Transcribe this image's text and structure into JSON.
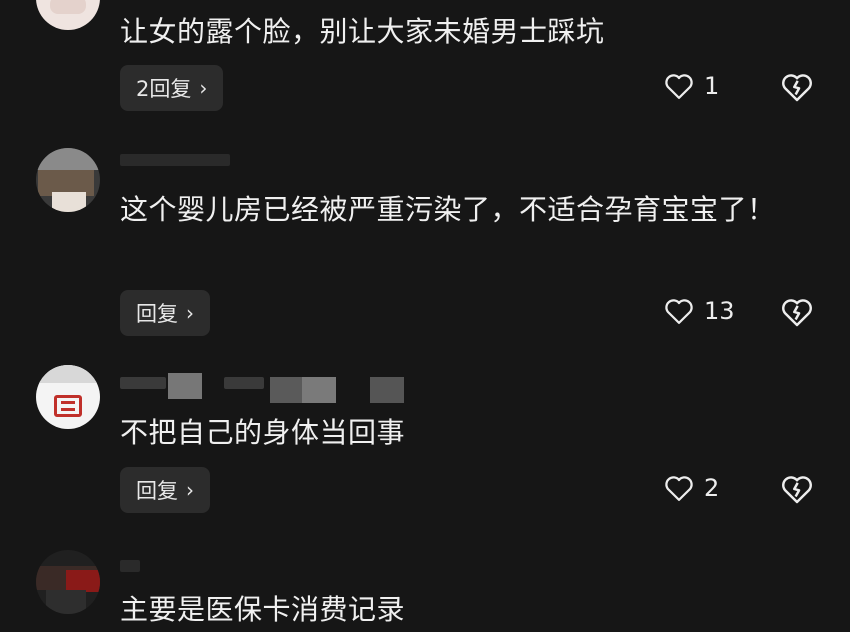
{
  "comments": [
    {
      "text": "让女的露个脸，别让大家未婚男士踩坑",
      "reply_label": "2回复",
      "like_count": "1"
    },
    {
      "text": "这个婴儿房已经被严重污染了，不适合孕育宝宝了！",
      "reply_label": "回复",
      "like_count": "13"
    },
    {
      "text": "不把自己的身体当回事",
      "reply_label": "回复",
      "like_count": "2"
    },
    {
      "text": "主要是医保卡消费记录"
    }
  ],
  "icons": {
    "like": "heart-icon",
    "dislike": "broken-heart-icon",
    "reply_chevron": "chevron-right-icon"
  },
  "colors": {
    "background": "#161616",
    "reply_button_bg": "#2c2c2c",
    "text": "#f0f0f0"
  }
}
